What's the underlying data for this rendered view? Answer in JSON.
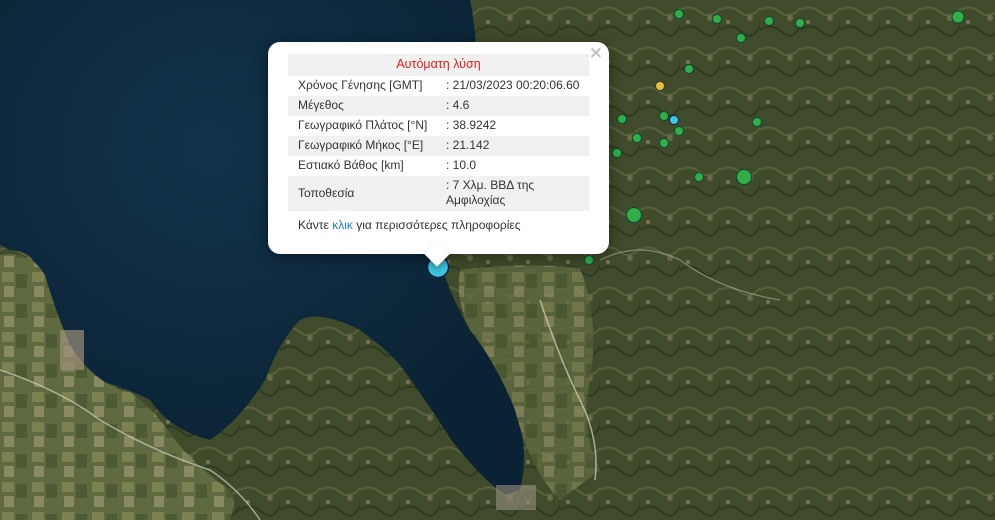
{
  "popup": {
    "close_symbol": "×",
    "header": "Αυτόματη λύση",
    "rows": [
      {
        "label": "Χρόνος Γένησης [GMT]",
        "value": ": 21/03/2023 00:20:06.60"
      },
      {
        "label": "Μέγεθος",
        "value": ": 4.6"
      },
      {
        "label": "Γεωγραφικό Πλάτος [°N]",
        "value": ": 38.9242"
      },
      {
        "label": "Γεωγραφικό Μήκος [°E]",
        "value": ": 21.142"
      },
      {
        "label": "Εστιακό Βάθος [km]",
        "value": ": 10.0"
      },
      {
        "label": "Τοποθεσία",
        "value": ": 7 Χλμ. ΒΒΔ της Αμφιλοχίας"
      }
    ],
    "more_prefix": "Κάντε ",
    "more_link": "κλικ",
    "more_suffix": " για περισσότερες πληροφορίες"
  },
  "colors": {
    "header_red": "#e0201d",
    "link_blue": "#1a83c4",
    "quake_green": "#2fae4a",
    "quake_yellow": "#e3c23a",
    "quake_cyan": "#3cc7e0",
    "sea": "#0f2a3c",
    "land": "#3f4b2a"
  },
  "icons": {
    "close": "close-icon",
    "main_marker": "earthquake-marker-icon"
  }
}
